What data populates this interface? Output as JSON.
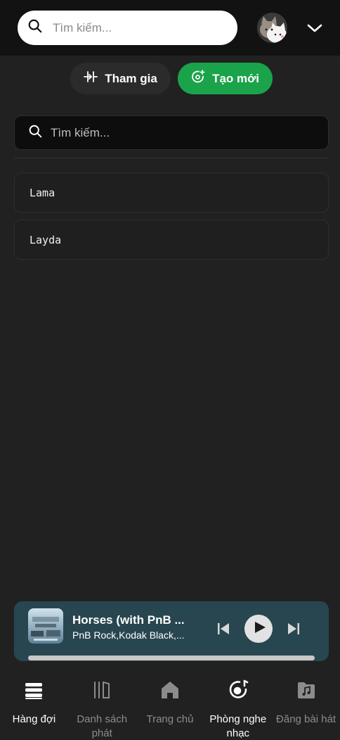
{
  "header": {
    "search_placeholder": "Tìm kiếm...",
    "icons": [
      "search-icon",
      "avatar",
      "chevron-down-icon"
    ]
  },
  "actions": {
    "join_label": "Tham gia",
    "create_label": "Tạo mới",
    "create_color": "#1aa34a"
  },
  "rooms": {
    "search_placeholder": "Tìm kiếm...",
    "items": [
      {
        "label": "Lama"
      },
      {
        "label": "Layda"
      }
    ]
  },
  "player": {
    "title": "Horses (with PnB ...",
    "artist": "PnB Rock,Kodak Black,...",
    "progress": 1.0,
    "background": "#284650"
  },
  "bottom_nav": {
    "items": [
      {
        "label": "Hàng đợi",
        "icon": "queue-icon",
        "active": true
      },
      {
        "label": "Danh sách phát",
        "icon": "library-icon",
        "active": false
      },
      {
        "label": "Trang chủ",
        "icon": "home-icon",
        "active": false
      },
      {
        "label": "Phòng nghe nhạc",
        "icon": "listening-room-icon",
        "active": true
      },
      {
        "label": "Đăng bài hát",
        "icon": "upload-song-icon",
        "active": false
      }
    ]
  }
}
